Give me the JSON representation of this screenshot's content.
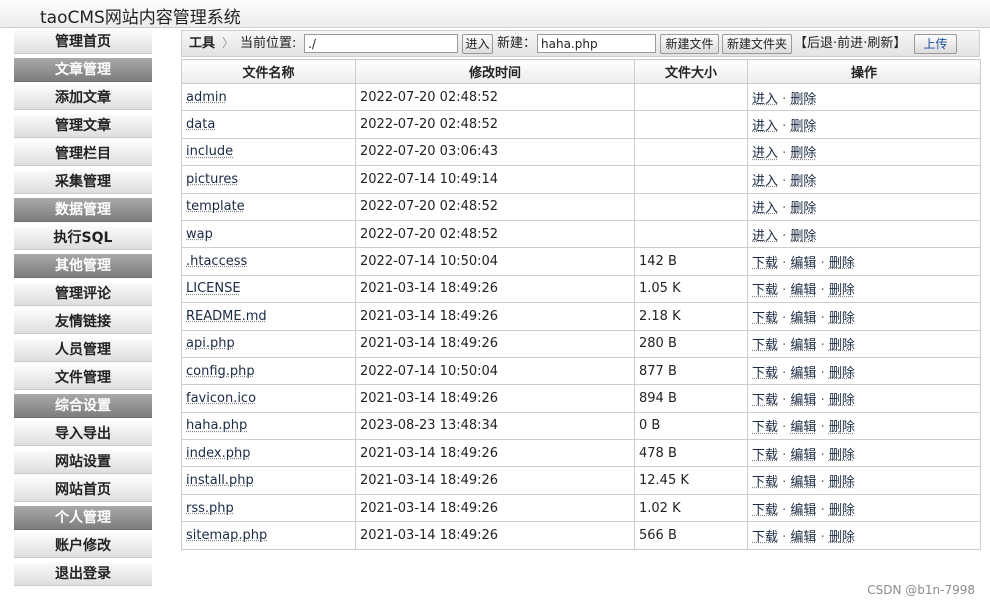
{
  "app": {
    "title": "taoCMS网站内容管理系统"
  },
  "sidebar": {
    "items": [
      {
        "label": "管理首页",
        "header": false
      },
      {
        "label": "文章管理",
        "header": true
      },
      {
        "label": "添加文章",
        "header": false
      },
      {
        "label": "管理文章",
        "header": false
      },
      {
        "label": "管理栏目",
        "header": false
      },
      {
        "label": "采集管理",
        "header": false
      },
      {
        "label": "数据管理",
        "header": true
      },
      {
        "label": "执行SQL",
        "header": false
      },
      {
        "label": "其他管理",
        "header": true
      },
      {
        "label": "管理评论",
        "header": false
      },
      {
        "label": "友情链接",
        "header": false
      },
      {
        "label": "人员管理",
        "header": false
      },
      {
        "label": "文件管理",
        "header": false
      },
      {
        "label": "综合设置",
        "header": true
      },
      {
        "label": "导入导出",
        "header": false
      },
      {
        "label": "网站设置",
        "header": false
      },
      {
        "label": "网站首页",
        "header": false
      },
      {
        "label": "个人管理",
        "header": true
      },
      {
        "label": "账户修改",
        "header": false
      },
      {
        "label": "退出登录",
        "header": false
      }
    ]
  },
  "toolbar": {
    "tools_label": "工具",
    "chevron": "〉",
    "path_label": "当前位置:",
    "path_value": "./",
    "enter_label": "进入",
    "new_label": "新建：",
    "new_name_value": "haha.php",
    "new_file_label": "新建文件",
    "new_folder_label": "新建文件夹",
    "nav_open": "【",
    "back_label": "后退",
    "forward_label": "前进",
    "refresh_label": "刷新",
    "nav_close": "】",
    "nav_sep": "·",
    "upload_label": "上传"
  },
  "table": {
    "headers": [
      "文件名称",
      "修改时间",
      "文件大小",
      "操作"
    ],
    "op_labels": {
      "enter": "进入",
      "delete": "删除",
      "download": "下载",
      "edit": "编辑"
    },
    "rows": [
      {
        "name": "admin",
        "mtime": "2022-07-20 02:48:52",
        "size": "",
        "type": "dir"
      },
      {
        "name": "data",
        "mtime": "2022-07-20 02:48:52",
        "size": "",
        "type": "dir"
      },
      {
        "name": "include",
        "mtime": "2022-07-20 03:06:43",
        "size": "",
        "type": "dir"
      },
      {
        "name": "pictures",
        "mtime": "2022-07-14 10:49:14",
        "size": "",
        "type": "dir"
      },
      {
        "name": "template",
        "mtime": "2022-07-20 02:48:52",
        "size": "",
        "type": "dir"
      },
      {
        "name": "wap",
        "mtime": "2022-07-20 02:48:52",
        "size": "",
        "type": "dir"
      },
      {
        "name": ".htaccess",
        "mtime": "2022-07-14 10:50:04",
        "size": "142 B",
        "type": "file"
      },
      {
        "name": "LICENSE",
        "mtime": "2021-03-14 18:49:26",
        "size": "1.05 K",
        "type": "file"
      },
      {
        "name": "README.md",
        "mtime": "2021-03-14 18:49:26",
        "size": "2.18 K",
        "type": "file"
      },
      {
        "name": "api.php",
        "mtime": "2021-03-14 18:49:26",
        "size": "280 B",
        "type": "file"
      },
      {
        "name": "config.php",
        "mtime": "2022-07-14 10:50:04",
        "size": "877 B",
        "type": "file"
      },
      {
        "name": "favicon.ico",
        "mtime": "2021-03-14 18:49:26",
        "size": "894 B",
        "type": "file"
      },
      {
        "name": "haha.php",
        "mtime": "2023-08-23 13:48:34",
        "size": "0 B",
        "type": "file"
      },
      {
        "name": "index.php",
        "mtime": "2021-03-14 18:49:26",
        "size": "478 B",
        "type": "file"
      },
      {
        "name": "install.php",
        "mtime": "2021-03-14 18:49:26",
        "size": "12.45 K",
        "type": "file"
      },
      {
        "name": "rss.php",
        "mtime": "2021-03-14 18:49:26",
        "size": "1.02 K",
        "type": "file"
      },
      {
        "name": "sitemap.php",
        "mtime": "2021-03-14 18:49:26",
        "size": "566 B",
        "type": "file"
      }
    ]
  },
  "watermark": "CSDN @b1n-7998"
}
